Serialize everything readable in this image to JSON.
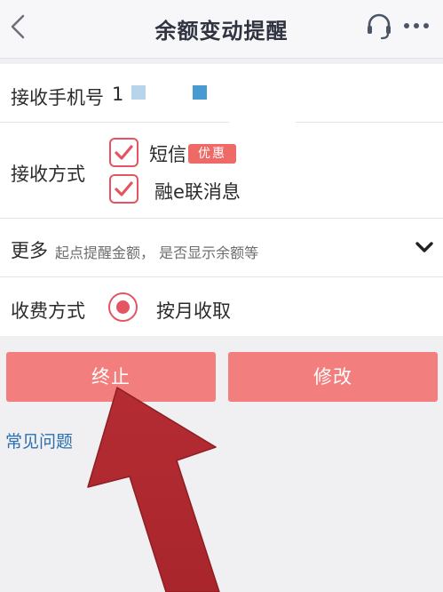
{
  "header": {
    "title": "余额变动提醒",
    "back_icon": "chevron-left-icon",
    "support_icon": "headset-icon",
    "more_icon": "more-dots-icon"
  },
  "phone": {
    "label": "接收手机号",
    "value": "1"
  },
  "method": {
    "label": "接收方式",
    "options": [
      {
        "label": "短信",
        "badge": "优惠",
        "checked": true
      },
      {
        "label": "融e联消息",
        "checked": true
      }
    ]
  },
  "more": {
    "label": "更多",
    "subtitle": "起点提醒金额， 是否显示余额等",
    "icon": "chevron-down-icon"
  },
  "fee": {
    "label": "收费方式",
    "value": "按月收取",
    "selected": true
  },
  "buttons": {
    "stop": "终止",
    "edit": "修改"
  },
  "faq": "常见问题",
  "colors": {
    "accent": "#e35560",
    "button": "#f37e7e",
    "link": "#2c6fb0",
    "arrow": "#c8363a"
  }
}
